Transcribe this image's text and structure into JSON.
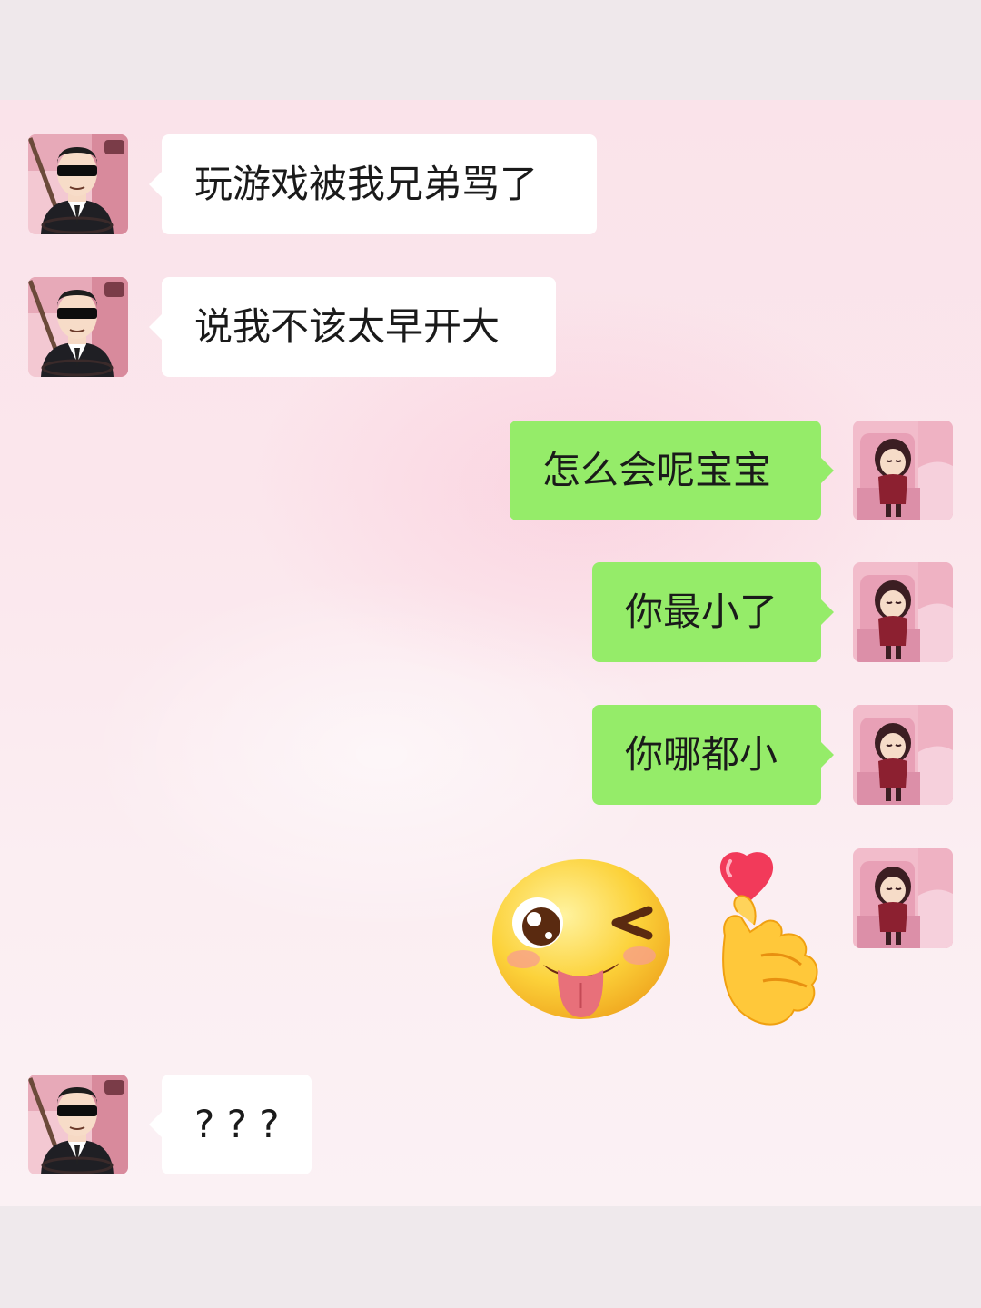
{
  "colors": {
    "outgoing_bubble": "#95ec69",
    "incoming_bubble": "#ffffff",
    "chat_background": "#fbe6ec"
  },
  "messages": [
    {
      "side": "left",
      "avatar": "man-in-sunglasses-avatar",
      "text": "玩游戏被我兄弟骂了"
    },
    {
      "side": "left",
      "avatar": "man-in-sunglasses-avatar",
      "text": "说我不该太早开大"
    },
    {
      "side": "right",
      "avatar": "girl-in-red-avatar",
      "text": "怎么会呢宝宝"
    },
    {
      "side": "right",
      "avatar": "girl-in-red-avatar",
      "text": "你最小了"
    },
    {
      "side": "right",
      "avatar": "girl-in-red-avatar",
      "text": "你哪都小"
    },
    {
      "side": "right",
      "avatar": "girl-in-red-avatar",
      "stickers": [
        "wink-tongue-emoji",
        "finger-heart-emoji"
      ]
    },
    {
      "side": "left",
      "avatar": "man-in-sunglasses-avatar",
      "text": "? ? ?"
    }
  ]
}
